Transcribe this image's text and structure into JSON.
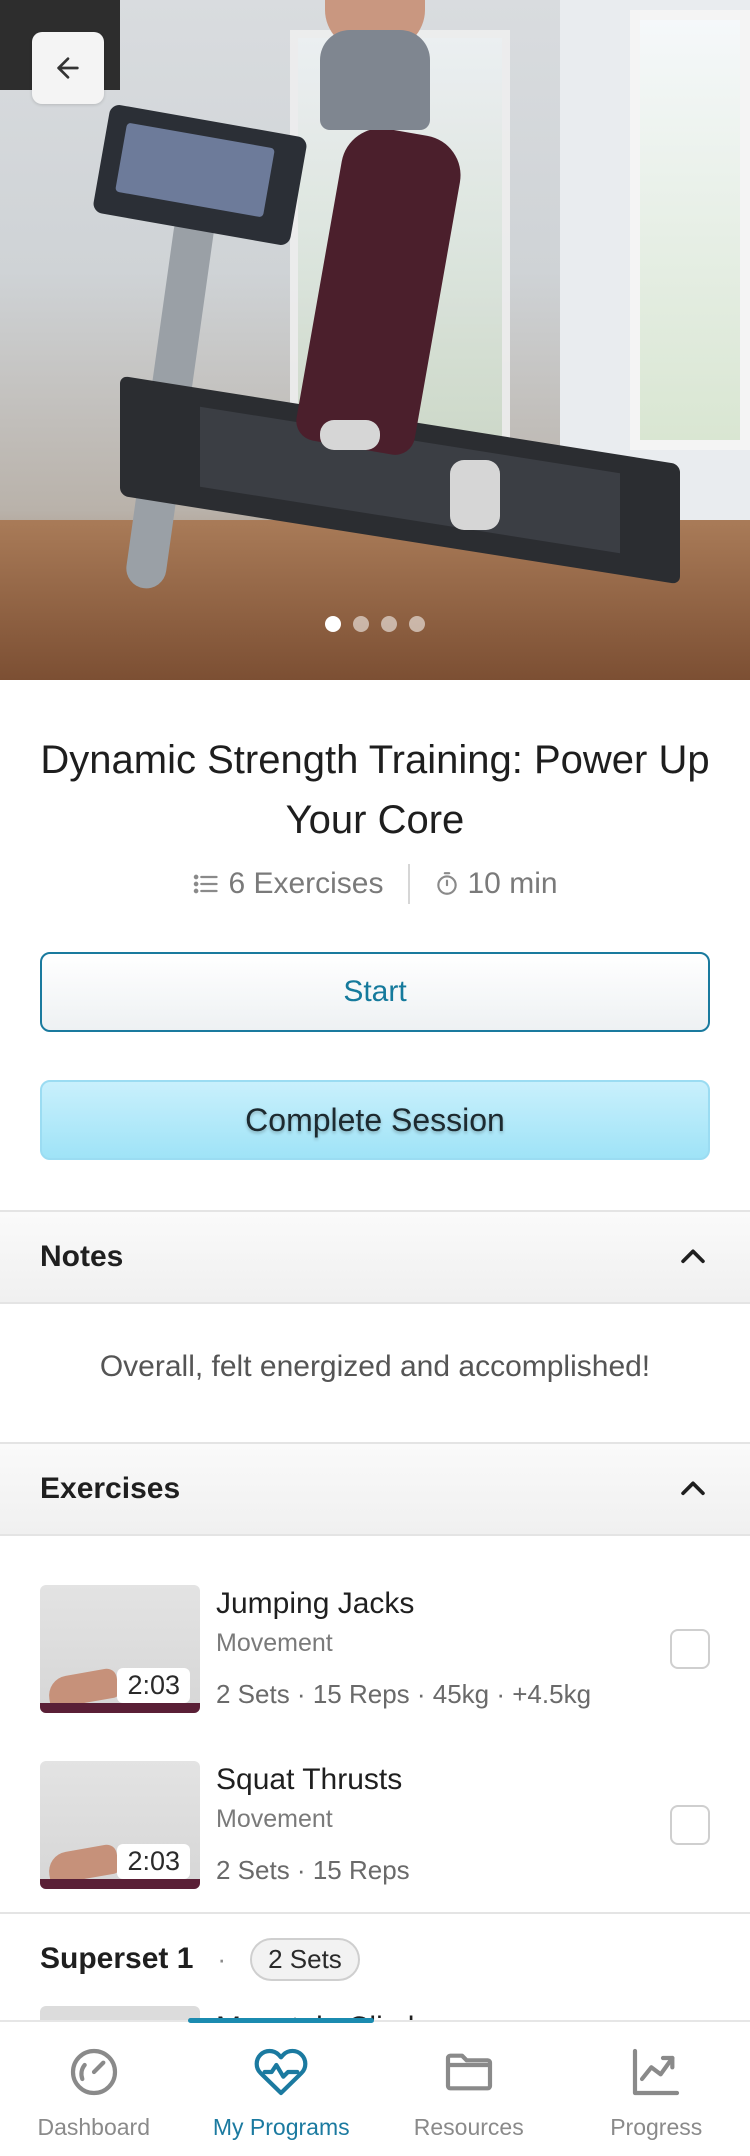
{
  "hero": {
    "image_alt": "Woman running on an incline treadmill",
    "carousel": {
      "count": 4,
      "active_index": 0
    },
    "back_icon": "arrow-left-icon"
  },
  "workout": {
    "title": "Dynamic Strength Training: Power Up Your Core",
    "exercise_count": "6 Exercises",
    "duration": "10 min"
  },
  "actions": {
    "start_label": "Start",
    "complete_label": "Complete Session"
  },
  "notes": {
    "header": "Notes",
    "text": "Overall, felt energized and accomplished!"
  },
  "exercises": {
    "header": "Exercises",
    "items": [
      {
        "name": "Jumping Jacks",
        "type": "Movement",
        "detail": "2 Sets · 15 Reps · 45kg · +4.5kg",
        "duration": "2:03"
      },
      {
        "name": "Squat Thrusts",
        "type": "Movement",
        "detail": "2 Sets · 15 Reps",
        "duration": "2:03"
      }
    ],
    "superset": {
      "name": "Superset 1",
      "separator": "·",
      "sets": "2 Sets",
      "first_item": "Mountain Climbers"
    }
  },
  "nav": {
    "items": [
      {
        "label": "Dashboard",
        "icon": "speedometer-icon"
      },
      {
        "label": "My Programs",
        "icon": "heart-pulse-icon"
      },
      {
        "label": "Resources",
        "icon": "folder-icon"
      },
      {
        "label": "Progress",
        "icon": "trend-chart-icon"
      }
    ],
    "active": "My Programs"
  },
  "colors": {
    "accent": "#1b7aa0",
    "complete_bg": "#a8e6f8",
    "header_bg": "#f4f4f4"
  }
}
